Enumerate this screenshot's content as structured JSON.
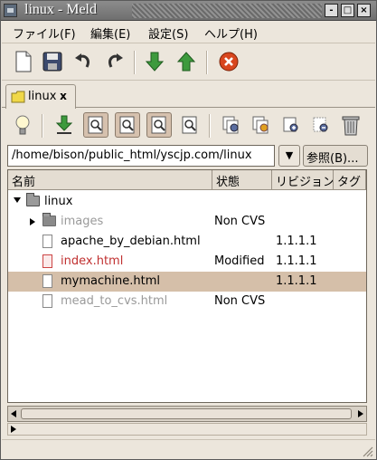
{
  "window": {
    "title": "linux - Meld"
  },
  "window_buttons": {
    "minimize": "-",
    "maximize": "□",
    "close": "×"
  },
  "menu": [
    {
      "label": "ファイル(F)"
    },
    {
      "label": "編集(E)"
    },
    {
      "label": "設定(S)"
    },
    {
      "label": "ヘルプ(H)"
    }
  ],
  "main_toolbar": {
    "icons": [
      "new-file-icon",
      "save-icon",
      "undo-icon",
      "redo-icon",
      "down-arrow-icon",
      "up-arrow-icon",
      "stop-icon"
    ]
  },
  "tab": {
    "label": "linux",
    "close_label": "x"
  },
  "vc_toolbar": {
    "icons": [
      "lightbulb-icon",
      "update-icon",
      "view-flat-icon",
      "view-modified-icon",
      "view-normal-icon",
      "view-non-vc-icon",
      "commit-icon",
      "add-icon",
      "add-binary-icon",
      "remove-icon",
      "delete-icon"
    ],
    "pressed": [
      "view-flat-icon",
      "view-modified-icon",
      "view-normal-icon"
    ]
  },
  "location": {
    "path": "/home/bison/public_html/yscjp.com/linux",
    "dropdown": "▼",
    "browse_label": "参照(B)..."
  },
  "tree": {
    "columns": [
      "名前",
      "状態",
      "リビジョン",
      "タグ"
    ],
    "rows": [
      {
        "name": "linux",
        "status": "",
        "revision": "",
        "type": "folder",
        "expander": "open",
        "depth": 0,
        "style": "normal"
      },
      {
        "name": "images",
        "status": "Non CVS",
        "revision": "",
        "type": "folder",
        "expander": "closed",
        "depth": 1,
        "style": "dim"
      },
      {
        "name": "apache_by_debian.html",
        "status": "",
        "revision": "1.1.1.1",
        "type": "file",
        "expander": "",
        "depth": 1,
        "style": "normal"
      },
      {
        "name": "index.html",
        "status": "Modified",
        "revision": "1.1.1.1",
        "type": "file",
        "expander": "",
        "depth": 1,
        "style": "modified"
      },
      {
        "name": "mymachine.html",
        "status": "",
        "revision": "1.1.1.1",
        "type": "file",
        "expander": "",
        "depth": 1,
        "style": "normal",
        "selected": true
      },
      {
        "name": "mead_to_cvs.html",
        "status": "Non CVS",
        "revision": "",
        "type": "file",
        "expander": "",
        "depth": 1,
        "style": "dim"
      }
    ]
  },
  "colors": {
    "selection": "#d5bfa9",
    "modified_text": "#c03030",
    "dim_text": "#9a9a9a",
    "title_bar": "#7a7a7a",
    "window_bg": "#ece6dc"
  }
}
